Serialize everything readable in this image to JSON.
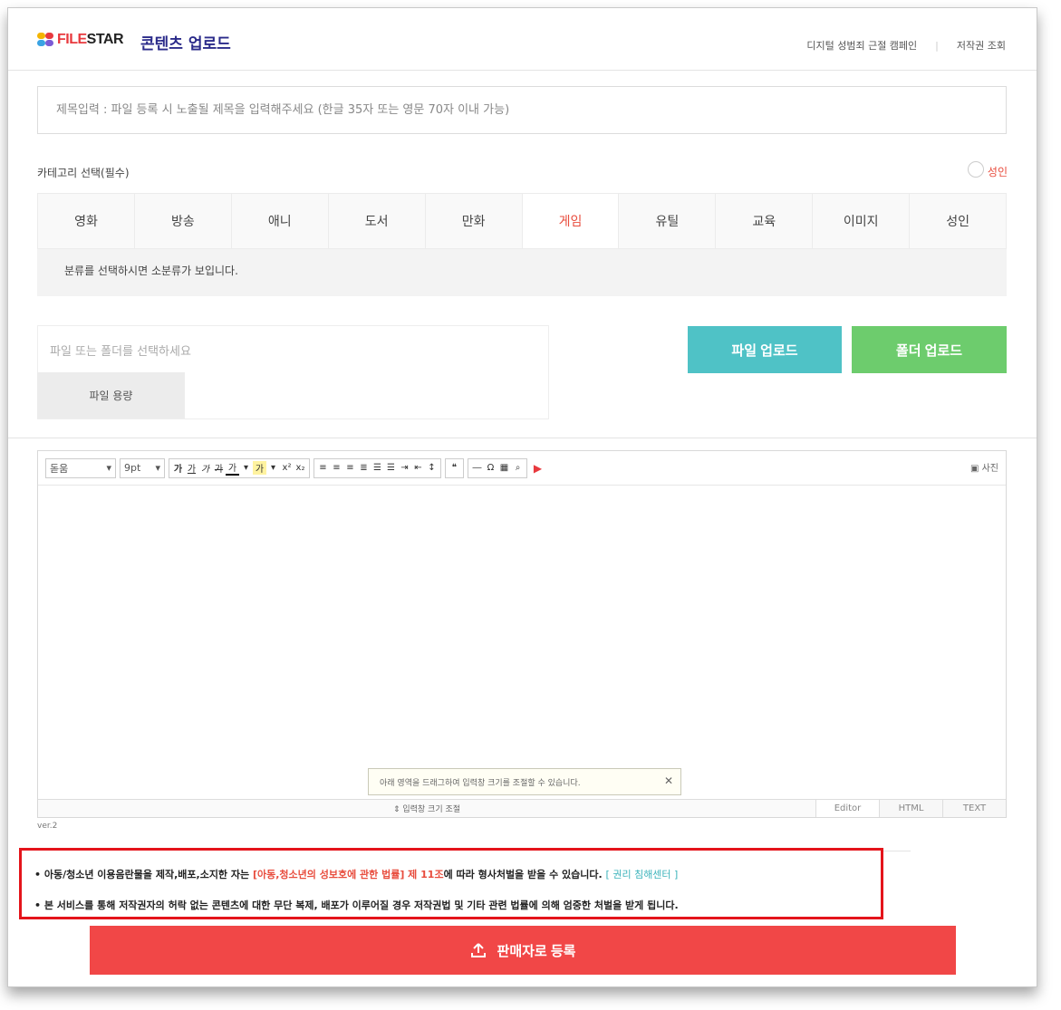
{
  "header": {
    "logo_file": "FILE",
    "logo_star": "STAR",
    "title": "콘텐츠 업로드",
    "links": [
      "디지털 성범죄 근절 캠페인",
      "저작권 조회"
    ],
    "colors": {
      "brand_red": "#e8393e",
      "title_navy": "#2b2b8a"
    }
  },
  "title_input": {
    "placeholder": "제목입력 : 파일 등록 시 노출될 제목을 입력해주세요 (한글 35자 또는 영문 70자 이내 가능)",
    "value": ""
  },
  "category": {
    "label": "카테고리 선택(필수)",
    "adult_label": "성인",
    "tabs": [
      "영화",
      "방송",
      "애니",
      "도서",
      "만화",
      "게임",
      "유틸",
      "교육",
      "이미지",
      "성인"
    ],
    "active_tab": "게임",
    "subcategory_hint": "분류를 선택하시면 소분류가 보입니다."
  },
  "file_select": {
    "placeholder": "파일 또는 폴더를 선택하세요",
    "size_label": "파일 용량",
    "file_upload_button": "파일 업로드",
    "folder_upload_button": "폴더 업로드",
    "colors": {
      "file_btn": "#4fc2c6",
      "folder_btn": "#6dcc6d"
    }
  },
  "editor": {
    "font_select": "돋움",
    "size_select": "9pt",
    "toolbar_icons": [
      "bold-icon",
      "underline-icon",
      "italic-icon",
      "strikethrough-icon",
      "font-color-icon",
      "highlight-icon",
      "superscript-icon",
      "subscript-icon",
      "align-left-icon",
      "align-center-icon",
      "align-right-icon",
      "justify-icon",
      "ordered-list-icon",
      "unordered-list-icon",
      "indent-icon",
      "outdent-icon",
      "line-height-icon",
      "quote-icon",
      "horizontal-rule-icon",
      "special-char-icon",
      "table-icon",
      "find-icon",
      "video-icon"
    ],
    "photo_button": "사진",
    "tooltip": "아래 영역을 드래그하여 입력창 크기를 조절할 수 있습니다.",
    "resize_label": "⇕ 입력창 크기 조절",
    "modes": [
      "Editor",
      "HTML",
      "TEXT"
    ],
    "active_mode": "Editor",
    "version": "ver.2"
  },
  "legal": {
    "line1_prefix": "• 아동/청소년 이용음란물을 제작,배포,소지한 자는 ",
    "line1_law": "[아동,청소년의 성보호에 관한 법률] 제 11조",
    "line1_suffix": "에 따라 형사처벌을 받을 수 있습니다.",
    "line1_link": "[ 권리 침해센터 ]",
    "line2": "• 본 서비스를 통해 저작권자의 허락 없는 콘텐츠에 대한 무단 복제, 배포가 이루어질 경우 저작권법 및 기타 관련 법률에 의해 엄중한 처벌을 받게 됩니다.",
    "colors": {
      "border": "#e4141b",
      "law": "#e84c3d",
      "link": "#3bb3bb"
    }
  },
  "register_button": {
    "label": "판매자로 등록",
    "color": "#f14747"
  }
}
